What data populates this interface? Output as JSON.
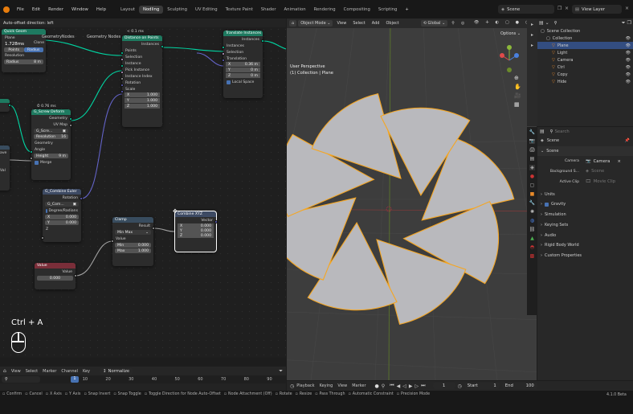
{
  "topbar": {
    "menus": [
      "File",
      "Edit",
      "Render",
      "Window",
      "Help"
    ],
    "workspaces": [
      "Layout",
      "Nodling",
      "Sculpting",
      "UV Editing",
      "Texture Paint",
      "Shader",
      "Animation",
      "Rendering",
      "Compositing",
      "Scripting"
    ],
    "active_workspace": "Nodling",
    "plus": "+",
    "scene": "Scene",
    "view_layer": "View Layer"
  },
  "node_editor": {
    "status": "Auto-offset direction: left",
    "frags": {
      "points": "Points",
      "radius": "Radius",
      "resolution": "Resolution",
      "radius_val": "8 m",
      "timing": "1.728ms"
    },
    "join": {
      "label": "Geometry"
    },
    "geo_nodes": {
      "title": "Geometry Nodes",
      "header_top": "Quick Geom",
      "header_2": "Plane",
      "field": "Clone",
      "label_geom_nodes": "GeometryNodes"
    },
    "distribute": {
      "time": "< 0.1 ms",
      "title": "Distance on Points",
      "inputs": [
        "Points",
        "Selection",
        "Instance",
        "Pick Instance",
        "Instance Index",
        "Rotation",
        "Scale"
      ],
      "output": "Instances",
      "scale": [
        {
          "axis": "X",
          "val": "1.000"
        },
        {
          "axis": "Y",
          "val": "1.000"
        },
        {
          "axis": "Z",
          "val": "1.000"
        }
      ]
    },
    "translate": {
      "title": "Translate Instances",
      "inputs": [
        "Instances",
        "Selection",
        "Translation"
      ],
      "output": "Instances",
      "vals": [
        {
          "axis": "X",
          "val": "0.36 m"
        },
        {
          "axis": "Y",
          "val": "0 m"
        },
        {
          "axis": "Z",
          "val": "0 m"
        }
      ],
      "local": "Local Space"
    },
    "screw": {
      "time": "0.76 ms",
      "title": "G_Screw Deform",
      "outputs": [
        "Geometry",
        "UV Map"
      ],
      "field": "G_Scre...",
      "resolution_label": "Resolution",
      "resolution_val": "16",
      "inputs": [
        "Geometry",
        "Angle"
      ],
      "height_label": "Height",
      "height_val": "9 m",
      "merge": "Merge"
    },
    "combine_euler": {
      "title": "G_Combine Euler",
      "output": "Rotation",
      "field": "G_Com...",
      "deg": "Degree/Radians",
      "vals": [
        {
          "axis": "X",
          "val": "0.000"
        },
        {
          "axis": "Y",
          "val": "0.000"
        }
      ],
      "z": "Z"
    },
    "clamp": {
      "title": "Clamp",
      "output": "Result",
      "mode": "Min Max",
      "input": "Value",
      "min_label": "Min",
      "min_val": "0.000",
      "max_label": "Max",
      "max_val": "1.000"
    },
    "combine_xyz": {
      "title": "Combine XYZ",
      "output": "Vector",
      "vals": [
        {
          "axis": "X",
          "val": "0.000"
        },
        {
          "axis": "Y",
          "val": "0.000"
        },
        {
          "axis": "Z",
          "val": "0.000"
        }
      ]
    },
    "value": {
      "title": "Value",
      "output": "Value",
      "val": "0.000"
    },
    "left_frag": {
      "a": "ave",
      "b": "Val"
    },
    "keycast": "Ctrl + A"
  },
  "viewport": {
    "mode": "Object Mode",
    "menus": [
      "View",
      "Select",
      "Add",
      "Object"
    ],
    "transform": "Global",
    "options": "Options",
    "perspective": "User Perspective",
    "collection": "(1) Collection | Plane"
  },
  "outliner": {
    "search": "",
    "items": [
      {
        "label": "Scene Collection",
        "sel": false,
        "indent": 0
      },
      {
        "label": "Collection",
        "sel": false,
        "indent": 1
      },
      {
        "label": "Plane",
        "sel": true,
        "indent": 2
      },
      {
        "label": "Light",
        "sel": false,
        "indent": 2
      },
      {
        "label": "Camera",
        "sel": false,
        "indent": 2
      },
      {
        "label": "Ctrl",
        "sel": false,
        "indent": 2
      },
      {
        "label": "Copy",
        "sel": false,
        "indent": 2
      },
      {
        "label": "Hide",
        "sel": false,
        "indent": 2
      }
    ]
  },
  "properties": {
    "search_placeholder": "Search",
    "scene_name": "Scene",
    "section": "Scene",
    "camera_label": "Camera",
    "camera_val": "Camera",
    "bg_label": "Background S...",
    "bg_val": "Scene",
    "clip_label": "Active Clip",
    "clip_val": "Movie Clip",
    "panels": [
      "Units",
      "Gravity",
      "Simulation",
      "Keying Sets",
      "Audio",
      "Rigid Body World",
      "Custom Properties"
    ]
  },
  "timeline": {
    "menus": [
      "View",
      "Select",
      "Marker",
      "Channel",
      "Key"
    ],
    "normalize": "Normalize",
    "frames": [
      "1",
      "10",
      "20",
      "30",
      "40",
      "50",
      "60",
      "70",
      "80",
      "90"
    ],
    "current": "1"
  },
  "playback": {
    "items": [
      "Playback",
      "Keying",
      "View",
      "Marker"
    ],
    "frame": "1",
    "start_label": "Start",
    "start": "1",
    "end_label": "End",
    "end": "100"
  },
  "statusbar": {
    "items": [
      "Confirm",
      "Cancel",
      "X Axis",
      "Y Axis",
      "Snap Invert",
      "Snap Toggle",
      "Toggle Direction for Node Auto-Offset",
      "Node Attachment (Off)",
      "Rotate",
      "Resize",
      "Pass Through",
      "Automatic Constraint",
      "Precision Mode"
    ],
    "version": "4.1.0 Beta"
  },
  "colors": {
    "accent": "#4772b3",
    "geo_socket": "#00d6a3",
    "outline": "#f5a623",
    "geo_header": "#1e7a60"
  }
}
